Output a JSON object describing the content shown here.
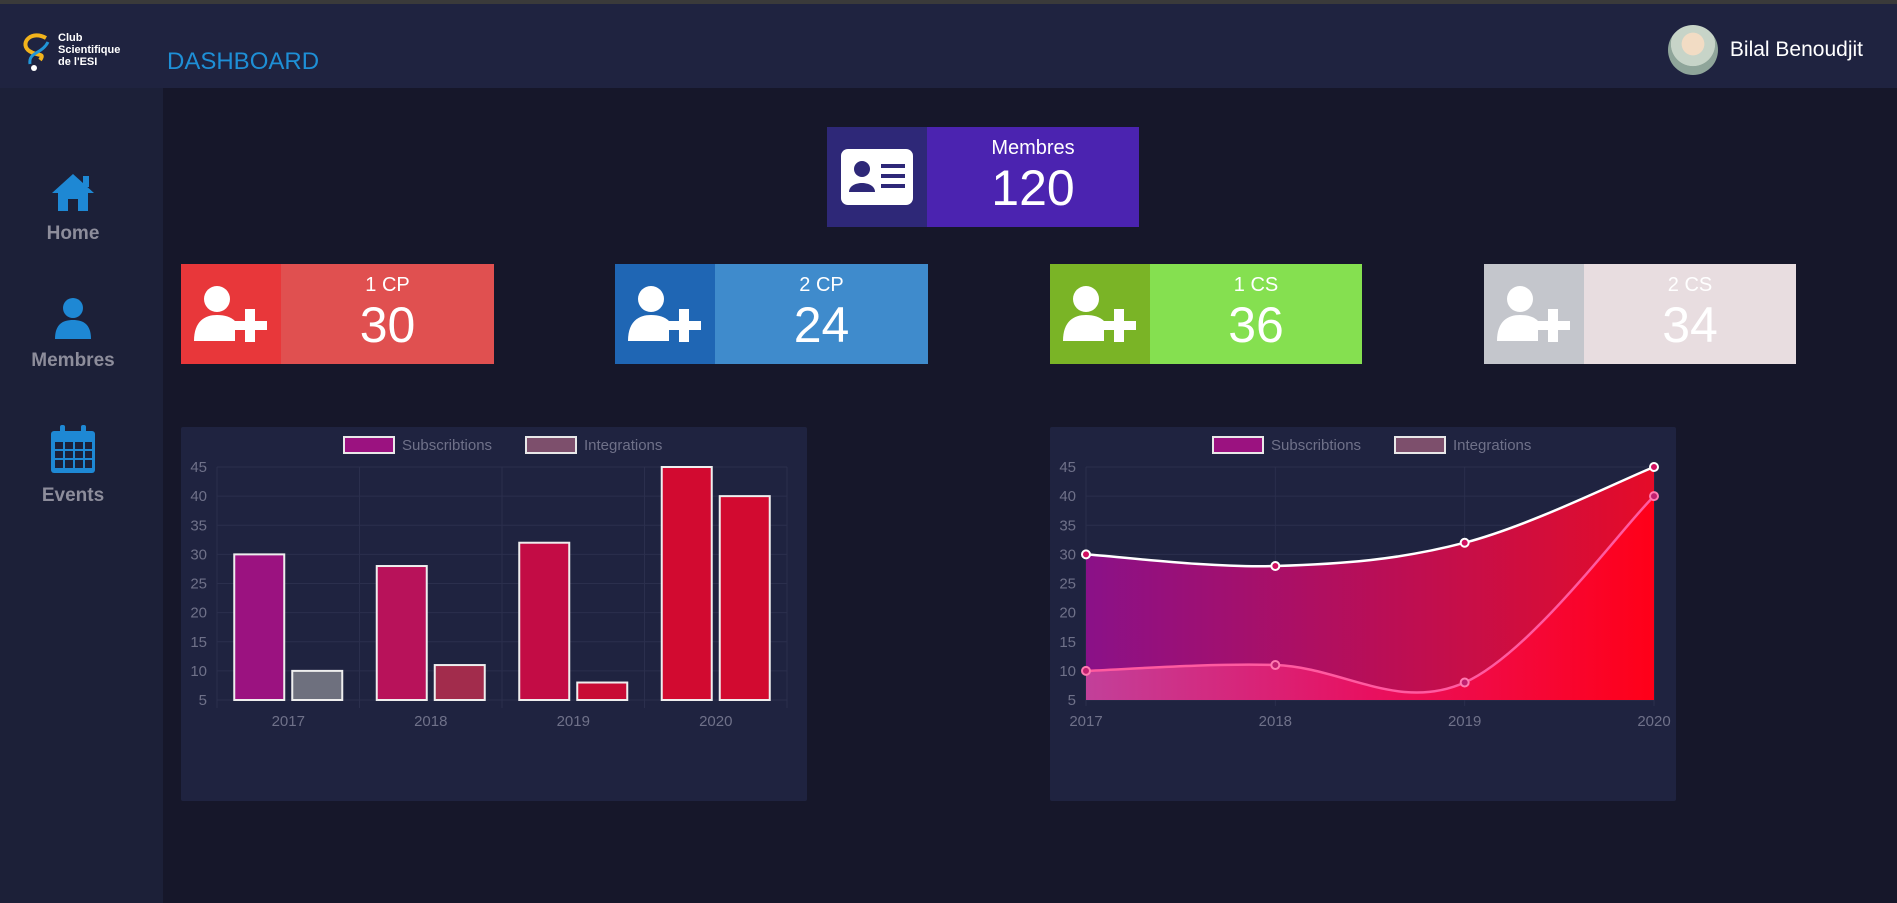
{
  "header": {
    "logo_lines": [
      "Club",
      "Scientifique",
      "de l'ESI"
    ],
    "title": "DASHBOARD",
    "user_name": "Bilal Benoudjit"
  },
  "sidebar": {
    "items": [
      {
        "label": "Home",
        "icon": "home-icon"
      },
      {
        "label": "Membres",
        "icon": "user-icon"
      },
      {
        "label": "Events",
        "icon": "calendar-icon"
      }
    ]
  },
  "summary": {
    "label": "Membres",
    "value": "120",
    "icon": "id-card-icon"
  },
  "cards": [
    {
      "label": "1 CP",
      "value": "30",
      "color": "#e05050",
      "icon_color": "#e8373a"
    },
    {
      "label": "2 CP",
      "value": "24",
      "color": "#3f8bcc",
      "icon_color": "#1f66b4"
    },
    {
      "label": "1 CS",
      "value": "36",
      "color": "#85e050",
      "icon_color": "#7ab426"
    },
    {
      "label": "2 CS",
      "value": "34",
      "color": "#e8dde0",
      "icon_color": "#c4c6cc"
    }
  ],
  "chart_data": [
    {
      "type": "bar",
      "categories": [
        "2017",
        "2018",
        "2019",
        "2020"
      ],
      "series": [
        {
          "name": "Subscribtions",
          "values": [
            30,
            28,
            32,
            45
          ]
        },
        {
          "name": "Integrations",
          "values": [
            10,
            11,
            8,
            40
          ]
        }
      ],
      "ylim": [
        5,
        45
      ],
      "yticks": [
        "45",
        "40",
        "35",
        "30",
        "25",
        "20",
        "15",
        "10",
        "5"
      ],
      "legend": "top-center",
      "grid": true
    },
    {
      "type": "area",
      "categories": [
        "2017",
        "2018",
        "2019",
        "2020"
      ],
      "series": [
        {
          "name": "Subscribtions",
          "values": [
            30,
            28,
            32,
            45
          ]
        },
        {
          "name": "Integrations",
          "values": [
            10,
            11,
            8,
            40
          ]
        }
      ],
      "ylim": [
        5,
        45
      ],
      "yticks": [
        "45",
        "40",
        "35",
        "30",
        "25",
        "20",
        "15",
        "10",
        "5"
      ],
      "legend": "top-center",
      "grid": true
    }
  ]
}
